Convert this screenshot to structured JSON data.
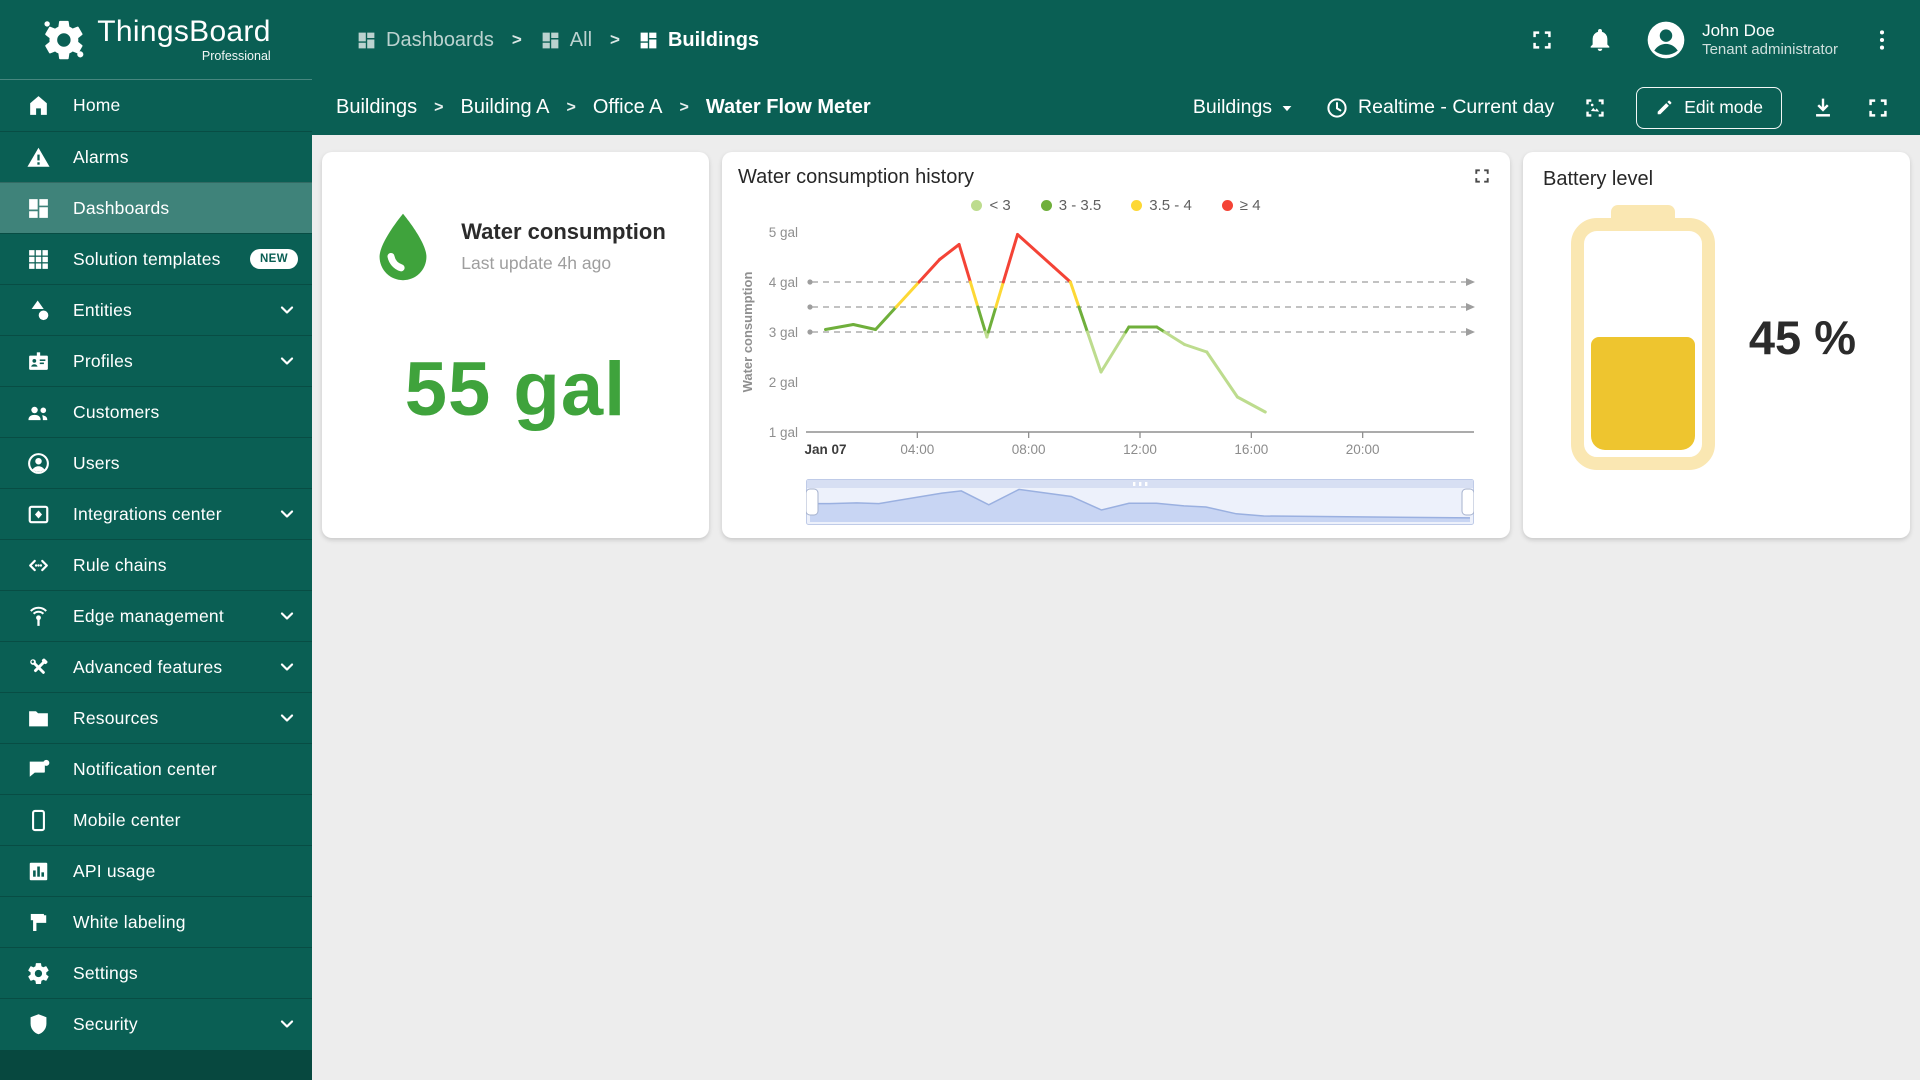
{
  "brand": {
    "name": "ThingsBoard",
    "edition": "Professional"
  },
  "header": {
    "breadcrumbs": [
      {
        "label": "Dashboards",
        "icon": "dashboards",
        "muted": true
      },
      {
        "label": "All",
        "icon": "dashboards",
        "muted": true
      },
      {
        "label": "Buildings",
        "icon": "dashboards",
        "muted": false
      }
    ],
    "user": {
      "name": "John Doe",
      "role": "Tenant administrator"
    }
  },
  "toolbar": {
    "path": [
      {
        "label": "Buildings",
        "current": false
      },
      {
        "label": "Building A",
        "current": false
      },
      {
        "label": "Office A",
        "current": false
      },
      {
        "label": "Water Flow Meter",
        "current": true
      }
    ],
    "dashboards_select": {
      "label": "Buildings"
    },
    "timewindow": {
      "label": "Realtime - Current day"
    },
    "edit_button": {
      "label": "Edit mode"
    }
  },
  "sidebar": {
    "items": [
      {
        "label": "Home",
        "icon": "home"
      },
      {
        "label": "Alarms",
        "icon": "alarms"
      },
      {
        "label": "Dashboards",
        "icon": "dashboards",
        "selected": true
      },
      {
        "label": "Solution templates",
        "icon": "solution-templates",
        "badge": "NEW"
      },
      {
        "label": "Entities",
        "icon": "entities",
        "expandable": true
      },
      {
        "label": "Profiles",
        "icon": "profiles",
        "expandable": true
      },
      {
        "label": "Customers",
        "icon": "customers"
      },
      {
        "label": "Users",
        "icon": "users"
      },
      {
        "label": "Integrations center",
        "icon": "integrations-center",
        "expandable": true
      },
      {
        "label": "Rule chains",
        "icon": "rule-chains"
      },
      {
        "label": "Edge management",
        "icon": "edge-management",
        "expandable": true
      },
      {
        "label": "Advanced features",
        "icon": "advanced-features",
        "expandable": true
      },
      {
        "label": "Resources",
        "icon": "resources",
        "expandable": true
      },
      {
        "label": "Notification center",
        "icon": "notification-center"
      },
      {
        "label": "Mobile center",
        "icon": "mobile-center"
      },
      {
        "label": "API usage",
        "icon": "api-usage"
      },
      {
        "label": "White labeling",
        "icon": "white-labeling"
      },
      {
        "label": "Settings",
        "icon": "settings"
      },
      {
        "label": "Security",
        "icon": "security",
        "expandable": true
      }
    ]
  },
  "widgets": {
    "water": {
      "title": "Water consumption",
      "subtitle": "Last update 4h ago",
      "value": "55 gal",
      "accent_color": "#3FA33C"
    },
    "history": {
      "title": "Water consumption history"
    },
    "battery": {
      "title": "Battery level",
      "value": "45 %",
      "percent": 45,
      "fill_color": "#EEC52F",
      "shell_color": "#FAE7B2"
    }
  },
  "chart_data": {
    "type": "line",
    "title": "Water consumption history",
    "ylabel": "Water consumption",
    "x_unit": "hour of day (Jan 07)",
    "x": [
      0.7,
      1.7,
      2.5,
      4.8,
      5.5,
      6.5,
      7.6,
      8.9,
      9.5,
      10.6,
      11.6,
      12.6,
      13.6,
      14.4,
      15.5,
      16.5
    ],
    "values": [
      3.05,
      3.15,
      3.05,
      4.45,
      4.75,
      2.9,
      4.95,
      4.3,
      4.0,
      2.2,
      3.1,
      3.1,
      2.75,
      2.6,
      1.7,
      1.4
    ],
    "xlim": [
      0,
      24
    ],
    "ylim": [
      1,
      5
    ],
    "yticks": [
      {
        "value": 5,
        "label": "5 gal"
      },
      {
        "value": 4,
        "label": "4 gal"
      },
      {
        "value": 3,
        "label": "3 gal"
      },
      {
        "value": 2,
        "label": "2 gal"
      },
      {
        "value": 1,
        "label": "1 gal"
      }
    ],
    "xticks": [
      {
        "hour": 0.7,
        "label": "Jan 07",
        "bold": true
      },
      {
        "hour": 4,
        "label": "04:00"
      },
      {
        "hour": 8,
        "label": "08:00"
      },
      {
        "hour": 12,
        "label": "12:00"
      },
      {
        "hour": 16,
        "label": "16:00"
      },
      {
        "hour": 20,
        "label": "20:00"
      }
    ],
    "thresholds": [
      3,
      3.5,
      4
    ],
    "legend_position": "top",
    "bands": [
      {
        "label": "< 3",
        "color": "#BDDC8E",
        "range": [
          null,
          3
        ]
      },
      {
        "label": "3 - 3.5",
        "color": "#6FAF3B",
        "range": [
          3,
          3.5
        ]
      },
      {
        "label": "3.5 - 4",
        "color": "#FDD835",
        "range": [
          3.5,
          4
        ]
      },
      {
        "label": "≥ 4",
        "color": "#F44336",
        "range": [
          4,
          null
        ]
      }
    ],
    "overview_slider": {
      "present": true,
      "window": "full"
    }
  }
}
